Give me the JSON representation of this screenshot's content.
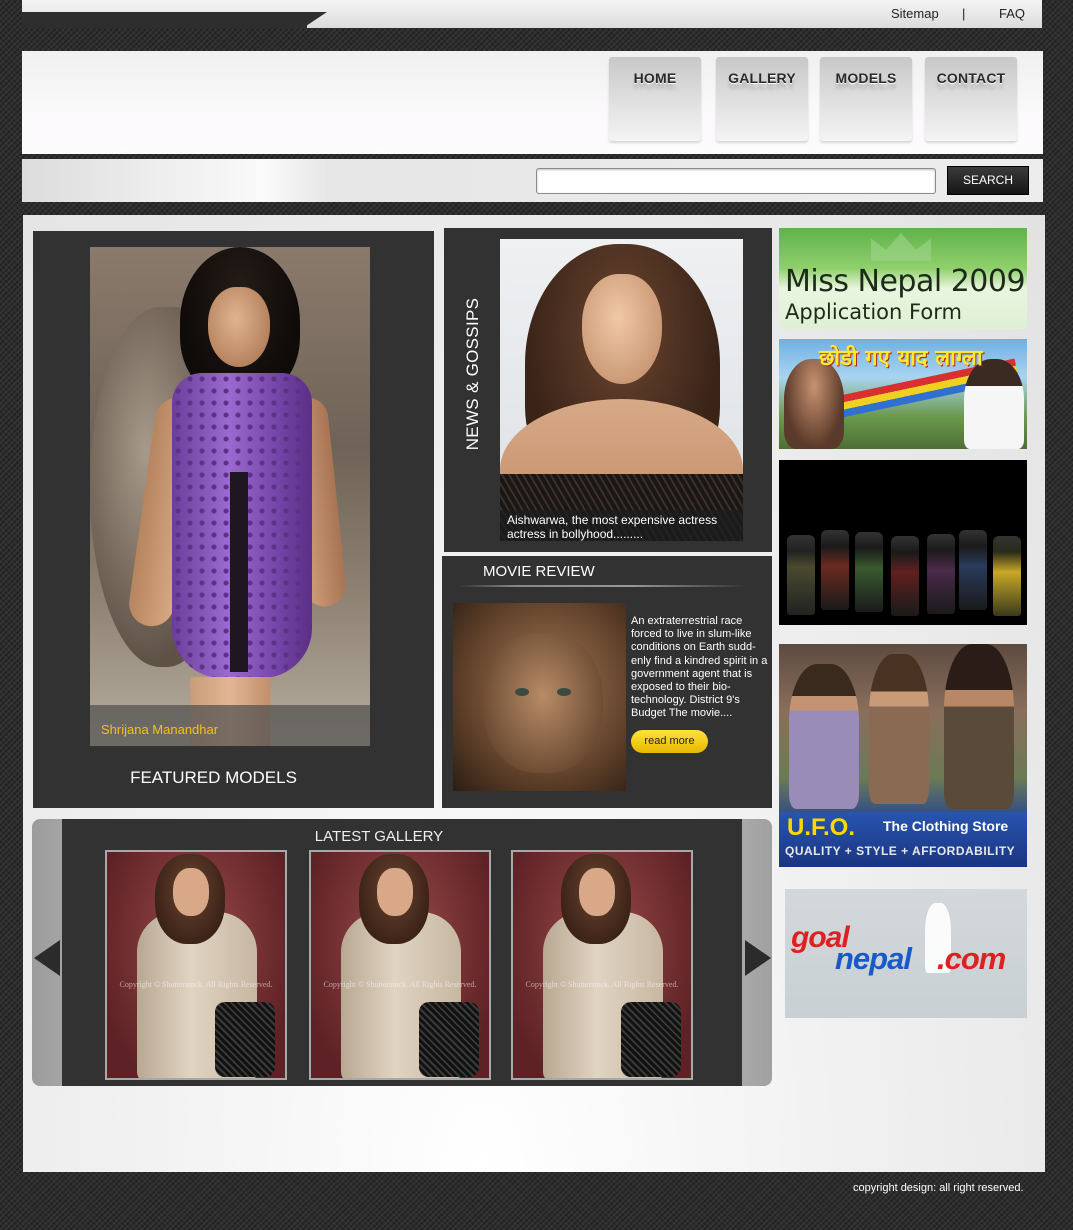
{
  "topbar": {
    "sitemap": "Sitemap",
    "separator": "|",
    "faq": "FAQ"
  },
  "nav": [
    {
      "label": "HOME"
    },
    {
      "label": "GALLERY"
    },
    {
      "label": "MODELS"
    },
    {
      "label": "CONTACT"
    }
  ],
  "search": {
    "value": "",
    "placeholder": "",
    "button": "SEARCH"
  },
  "featured": {
    "model_name": "Shrijana Manandhar",
    "title": "FEATURED MODELS"
  },
  "news": {
    "label": "NEWS & GOSSIPS",
    "caption": "Aishwarwa, the most expensive actress actress in bollyhood........."
  },
  "movie_review": {
    "title": "MOVIE REVIEW",
    "text": "An extraterrestrial race forced to live in slum-like conditions on Earth sudd-enly find a kindred spirit in a government agent that is exposed to their bio-technology. District 9's Budget The movie....",
    "button": "read more"
  },
  "gallery": {
    "title": "LATEST GALLERY",
    "thumb_watermark": "Copyright © Shutterstock. All Rights Reserved."
  },
  "ads": {
    "miss_nepal": {
      "title": "Miss Nepal 2009",
      "subtitle": "Application Form"
    },
    "movie_banner": {
      "title": "छोडी गए याद लाग्ला"
    },
    "ufo": {
      "brand": "U.F.O.",
      "store": "The Clothing Store",
      "tagline": "QUALITY + STYLE + AFFORDABILITY"
    },
    "goalnepal": {
      "part1": "goal",
      "part2": "nepal",
      "part3": ".com"
    }
  },
  "footer": {
    "copyright": "copyright design: all right reserved."
  },
  "colors": {
    "accent": "#f0c020",
    "panel": "#323232",
    "button_yellow": "#ffe23a"
  }
}
